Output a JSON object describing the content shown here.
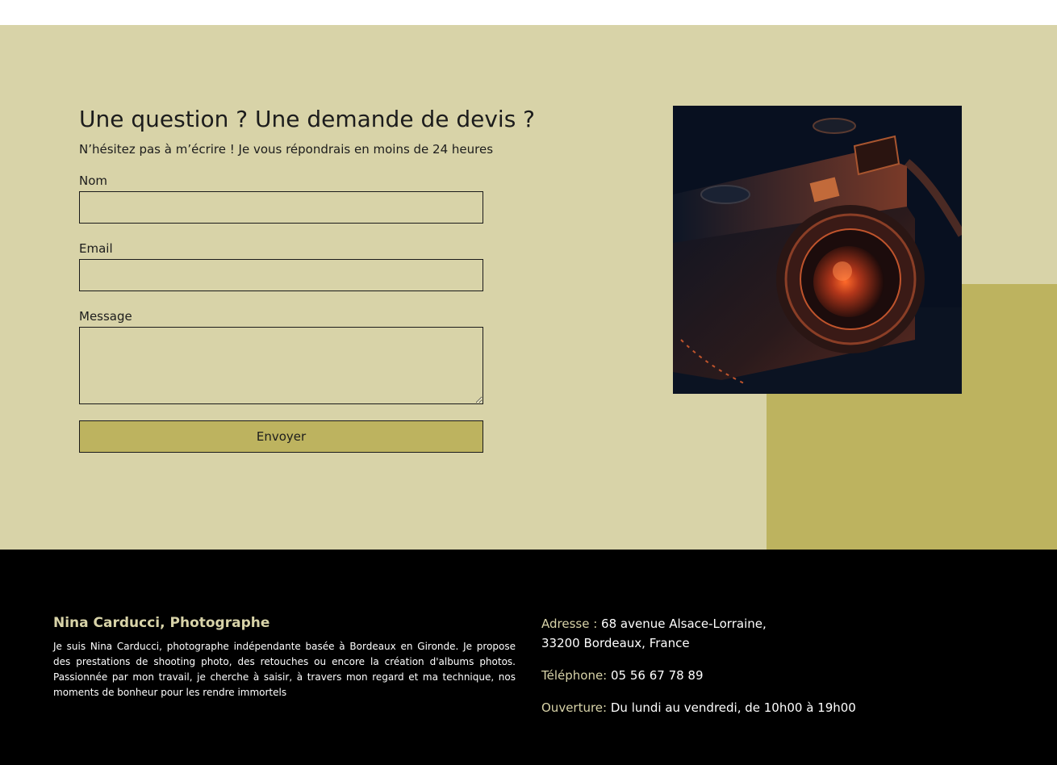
{
  "contact": {
    "title": "Une question ? Une demande de devis ?",
    "subtitle": "N’hésitez pas à m’écrire ! Je vous répondrais en moins de 24 heures",
    "name_label": "Nom",
    "name_value": "",
    "email_label": "Email",
    "email_value": "",
    "message_label": "Message",
    "message_value": "",
    "submit_label": "Envoyer"
  },
  "image": {
    "subject": "camera-photo",
    "alt": "Appareil photo"
  },
  "footer": {
    "name": "Nina Carducci, Photographe",
    "bio": "Je suis Nina Carducci, photographe indépendante basée à Bordeaux en Gironde. Je propose des prestations de shooting photo, des retouches ou encore la création d'albums photos. Passionnée par mon travail, je cherche à saisir, à travers mon regard et ma technique, nos moments de bonheur pour les rendre immortels",
    "address_label": "Adresse :",
    "address_line1": "68 avenue Alsace-Lorraine,",
    "address_line2": "33200 Bordeaux, France",
    "phone_label": "Téléphone:",
    "phone_value": "05 56 67 78 89",
    "hours_label": "Ouverture:",
    "hours_value": "Du lundi au vendredi, de 10h00 à 19h00"
  },
  "colors": {
    "section_bg": "#d8d3a8",
    "accent": "#bdb35f",
    "footer_bg": "#000000",
    "footer_label": "#d8d3a8"
  }
}
